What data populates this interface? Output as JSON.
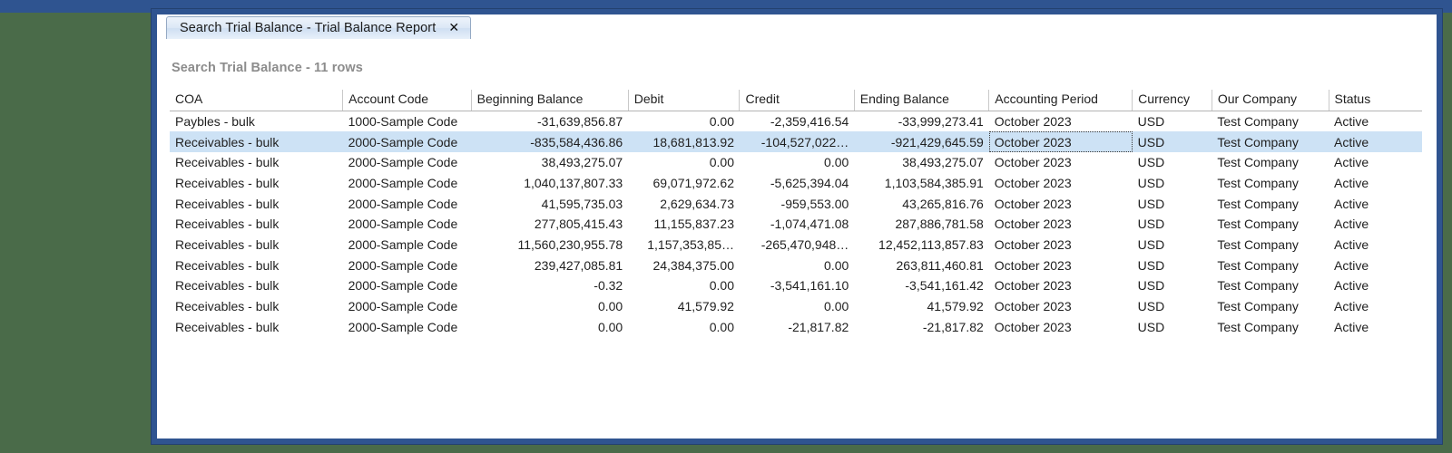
{
  "window": {
    "border_color": "#2f5490",
    "desktop_background": "#4a6b49"
  },
  "tab": {
    "label": "Search Trial Balance - Trial Balance Report",
    "close_glyph": "✕"
  },
  "heading": {
    "text": "Search Trial Balance - 11 rows"
  },
  "grid": {
    "selected_row_index": 1,
    "selected_row_color": "#cde2f5",
    "focused_cell": {
      "row": 1,
      "column": "accounting_period"
    },
    "columns": [
      {
        "key": "coa",
        "label": "COA",
        "align": "left"
      },
      {
        "key": "account_code",
        "label": "Account Code",
        "align": "left"
      },
      {
        "key": "beginning_balance",
        "label": "Beginning Balance",
        "align": "right"
      },
      {
        "key": "debit",
        "label": "Debit",
        "align": "right"
      },
      {
        "key": "credit",
        "label": "Credit",
        "align": "right"
      },
      {
        "key": "ending_balance",
        "label": "Ending Balance",
        "align": "right"
      },
      {
        "key": "accounting_period",
        "label": "Accounting Period",
        "align": "left"
      },
      {
        "key": "currency",
        "label": "Currency",
        "align": "left"
      },
      {
        "key": "our_company",
        "label": "Our Company",
        "align": "left"
      },
      {
        "key": "status",
        "label": "Status",
        "align": "left"
      }
    ],
    "rows": [
      {
        "coa": "Paybles - bulk",
        "account_code": "1000-Sample Code",
        "beginning_balance": "-31,639,856.87",
        "debit": "0.00",
        "credit": "-2,359,416.54",
        "ending_balance": "-33,999,273.41",
        "accounting_period": "October 2023",
        "currency": "USD",
        "our_company": "Test Company",
        "status": "Active"
      },
      {
        "coa": "Receivables - bulk",
        "account_code": "2000-Sample Code",
        "beginning_balance": "-835,584,436.86",
        "debit": "18,681,813.92",
        "credit": "-104,527,022…",
        "ending_balance": "-921,429,645.59",
        "accounting_period": "October 2023",
        "currency": "USD",
        "our_company": "Test Company",
        "status": "Active"
      },
      {
        "coa": "Receivables - bulk",
        "account_code": "2000-Sample Code",
        "beginning_balance": "38,493,275.07",
        "debit": "0.00",
        "credit": "0.00",
        "ending_balance": "38,493,275.07",
        "accounting_period": "October 2023",
        "currency": "USD",
        "our_company": "Test Company",
        "status": "Active"
      },
      {
        "coa": "Receivables - bulk",
        "account_code": "2000-Sample Code",
        "beginning_balance": "1,040,137,807.33",
        "debit": "69,071,972.62",
        "credit": "-5,625,394.04",
        "ending_balance": "1,103,584,385.91",
        "accounting_period": "October 2023",
        "currency": "USD",
        "our_company": "Test Company",
        "status": "Active"
      },
      {
        "coa": "Receivables - bulk",
        "account_code": "2000-Sample Code",
        "beginning_balance": "41,595,735.03",
        "debit": "2,629,634.73",
        "credit": "-959,553.00",
        "ending_balance": "43,265,816.76",
        "accounting_period": "October 2023",
        "currency": "USD",
        "our_company": "Test Company",
        "status": "Active"
      },
      {
        "coa": "Receivables - bulk",
        "account_code": "2000-Sample Code",
        "beginning_balance": "277,805,415.43",
        "debit": "11,155,837.23",
        "credit": "-1,074,471.08",
        "ending_balance": "287,886,781.58",
        "accounting_period": "October 2023",
        "currency": "USD",
        "our_company": "Test Company",
        "status": "Active"
      },
      {
        "coa": "Receivables - bulk",
        "account_code": "2000-Sample Code",
        "beginning_balance": "11,560,230,955.78",
        "debit": "1,157,353,85…",
        "credit": "-265,470,948…",
        "ending_balance": "12,452,113,857.83",
        "accounting_period": "October 2023",
        "currency": "USD",
        "our_company": "Test Company",
        "status": "Active"
      },
      {
        "coa": "Receivables - bulk",
        "account_code": "2000-Sample Code",
        "beginning_balance": "239,427,085.81",
        "debit": "24,384,375.00",
        "credit": "0.00",
        "ending_balance": "263,811,460.81",
        "accounting_period": "October 2023",
        "currency": "USD",
        "our_company": "Test Company",
        "status": "Active"
      },
      {
        "coa": "Receivables - bulk",
        "account_code": "2000-Sample Code",
        "beginning_balance": "-0.32",
        "debit": "0.00",
        "credit": "-3,541,161.10",
        "ending_balance": "-3,541,161.42",
        "accounting_period": "October 2023",
        "currency": "USD",
        "our_company": "Test Company",
        "status": "Active"
      },
      {
        "coa": "Receivables - bulk",
        "account_code": "2000-Sample Code",
        "beginning_balance": "0.00",
        "debit": "41,579.92",
        "credit": "0.00",
        "ending_balance": "41,579.92",
        "accounting_period": "October 2023",
        "currency": "USD",
        "our_company": "Test Company",
        "status": "Active"
      },
      {
        "coa": "Receivables - bulk",
        "account_code": "2000-Sample Code",
        "beginning_balance": "0.00",
        "debit": "0.00",
        "credit": "-21,817.82",
        "ending_balance": "-21,817.82",
        "accounting_period": "October 2023",
        "currency": "USD",
        "our_company": "Test Company",
        "status": "Active"
      }
    ]
  }
}
